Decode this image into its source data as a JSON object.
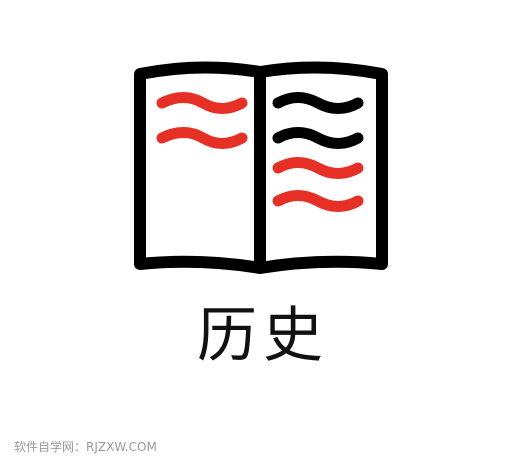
{
  "icon": {
    "name": "open-book-icon",
    "stroke_color": "#000000",
    "accent_color": "#e63026",
    "page_fill": "#ffffff",
    "left_page_lines": [
      "red",
      "red"
    ],
    "right_page_lines": [
      "black",
      "black",
      "red",
      "red"
    ]
  },
  "caption": {
    "text": "历史"
  },
  "watermark": {
    "text": "软件自学网：RJZXW.COM"
  }
}
